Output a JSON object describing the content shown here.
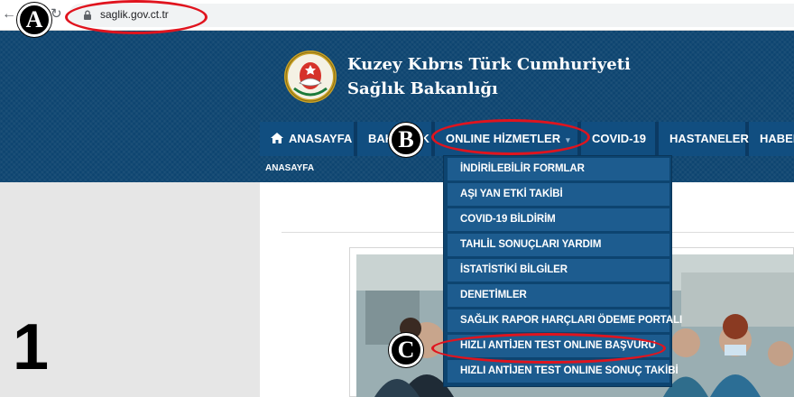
{
  "browser": {
    "url": "saglik.gov.ct.tr",
    "back_glyph": "←",
    "reload_glyph": "↻"
  },
  "header": {
    "title_line1": "Kuzey Kıbrıs Türk Cumhuriyeti",
    "title_line2": "Sağlık Bakanlığı"
  },
  "nav": {
    "home": "ANASAYFA",
    "about": "BAKANLIK",
    "online": "ONLINE HİZMETLER",
    "covid": "COVID-19",
    "hospitals": "HASTANELER",
    "news": "HABERLER"
  },
  "breadcrumb": "ANASAYFA",
  "dropdown": {
    "items": [
      "İNDİRİLEBİLİR FORMLAR",
      "AŞI YAN ETKİ TAKİBİ",
      "COVID-19 BİLDİRİM",
      "TAHLİL SONUÇLARI YARDIM",
      "İSTATİSTİKİ BİLGİLER",
      "DENETİMLER",
      "SAĞLIK RAPOR HARÇLARI ÖDEME PORTALI",
      "HIZLI ANTİJEN TEST ONLINE BAŞVURU",
      "HIZLI ANTİJEN TEST ONLINE SONUÇ TAKİBİ"
    ]
  },
  "annotations": {
    "marker_a": "A",
    "marker_b": "B",
    "marker_c": "C",
    "step_number": "1",
    "highlight_color": "#e0141e"
  },
  "colors": {
    "header_blue": "#0d4470",
    "nav_item_blue": "#114e80",
    "dropdown_item_blue": "#1d5c8f"
  },
  "icons": {
    "lock": "lock-icon",
    "home": "home-icon",
    "emblem": "state-emblem-icon"
  }
}
